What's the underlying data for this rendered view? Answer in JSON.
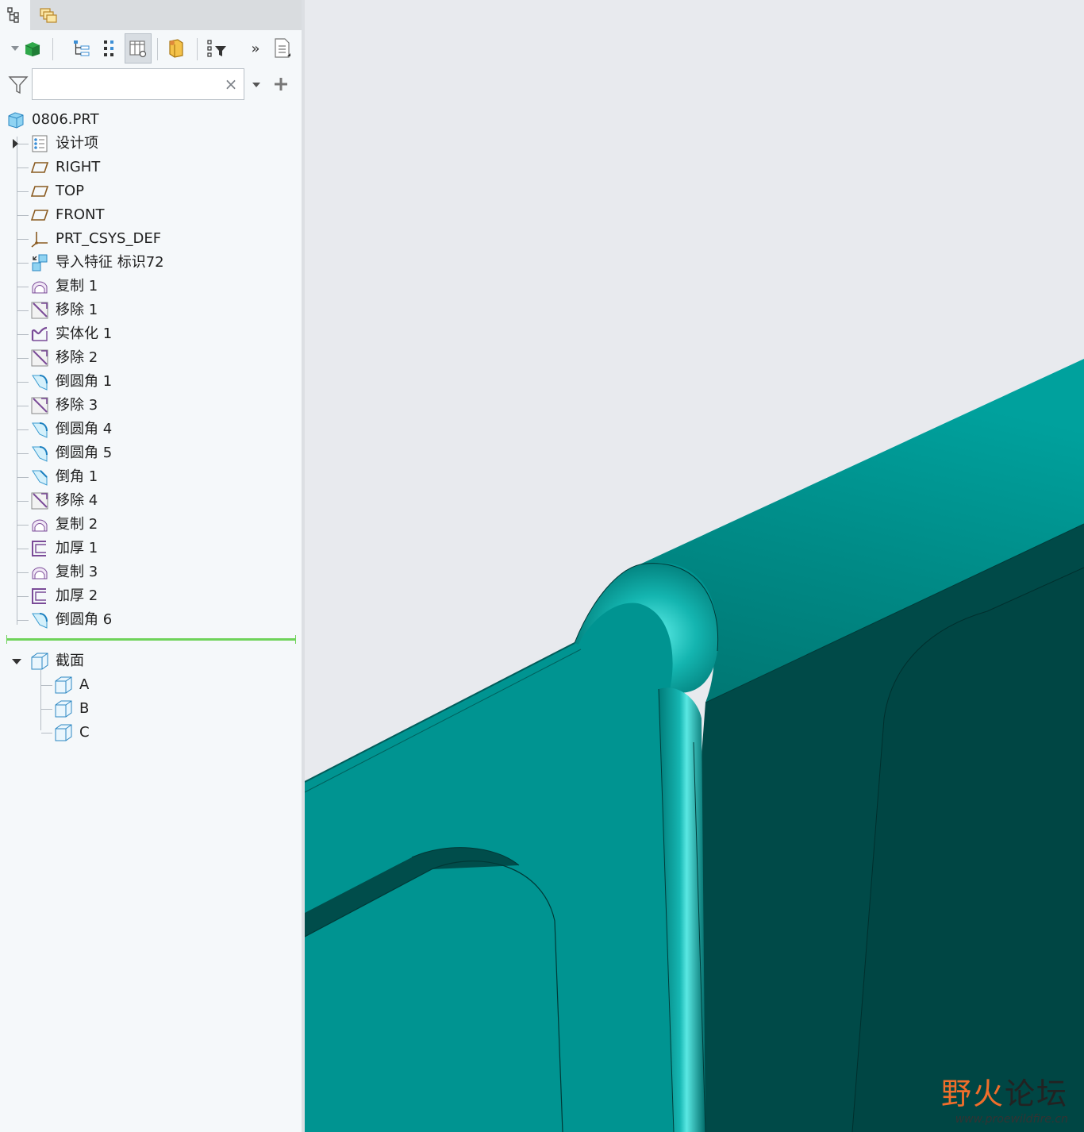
{
  "tabs": [
    {
      "id": "model-tree",
      "icon": "model-tree-icon"
    },
    {
      "id": "layers",
      "icon": "layers-icon"
    }
  ],
  "toolbar": {
    "more_label": "»"
  },
  "search": {
    "value": "",
    "placeholder": ""
  },
  "tree": {
    "root": {
      "label": "0806.PRT",
      "icon": "part-icon"
    },
    "items": [
      {
        "label": "设计项",
        "icon": "design-items-icon"
      },
      {
        "label": "RIGHT",
        "icon": "datum-plane-icon"
      },
      {
        "label": "TOP",
        "icon": "datum-plane-icon"
      },
      {
        "label": "FRONT",
        "icon": "datum-plane-icon"
      },
      {
        "label": "PRT_CSYS_DEF",
        "icon": "csys-icon"
      },
      {
        "label": "导入特征 标识72",
        "icon": "import-feature-icon"
      },
      {
        "label": "复制 1",
        "icon": "copy-surface-icon"
      },
      {
        "label": "移除 1",
        "icon": "remove-icon"
      },
      {
        "label": "实体化 1",
        "icon": "solidify-icon"
      },
      {
        "label": "移除 2",
        "icon": "remove-icon"
      },
      {
        "label": "倒圆角 1",
        "icon": "round-icon"
      },
      {
        "label": "移除 3",
        "icon": "remove-icon"
      },
      {
        "label": "倒圆角 4",
        "icon": "round-icon"
      },
      {
        "label": "倒圆角 5",
        "icon": "round-icon"
      },
      {
        "label": "倒角 1",
        "icon": "chamfer-icon"
      },
      {
        "label": "移除 4",
        "icon": "remove-icon"
      },
      {
        "label": "复制 2",
        "icon": "copy-surface-icon"
      },
      {
        "label": "加厚 1",
        "icon": "thicken-icon"
      },
      {
        "label": "复制 3",
        "icon": "copy-surface-icon"
      },
      {
        "label": "加厚 2",
        "icon": "thicken-icon"
      },
      {
        "label": "倒圆角 6",
        "icon": "round-icon"
      }
    ],
    "sections": {
      "label": "截面",
      "items": [
        {
          "label": "A"
        },
        {
          "label": "B"
        },
        {
          "label": "C"
        }
      ]
    }
  },
  "colors": {
    "model_teal": "#009491",
    "model_dark": "#004a48",
    "model_highlight": "#33d6d2",
    "background": "#e8eaee",
    "insert_indicator": "#6fd35a"
  },
  "watermark": {
    "brand_part1": "野火",
    "brand_part2": "论坛",
    "url": "www.proewildfire.cn"
  }
}
